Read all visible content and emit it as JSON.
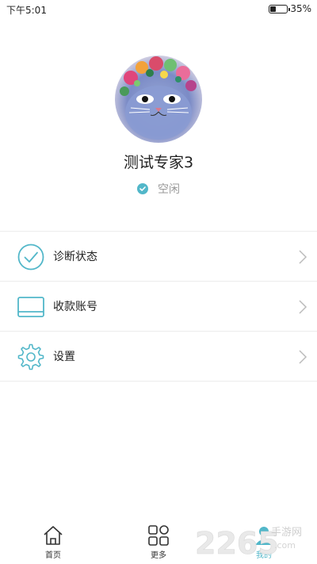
{
  "status_bar": {
    "time": "下午5:01",
    "battery_percent": "35%",
    "battery_level": 0.35
  },
  "profile": {
    "name": "测试专家3",
    "status": "空闲"
  },
  "menu": [
    {
      "label": "诊断状态",
      "icon": "check-circle-icon"
    },
    {
      "label": "收款账号",
      "icon": "card-icon"
    },
    {
      "label": "设置",
      "icon": "gear-icon"
    }
  ],
  "nav": [
    {
      "label": "首页",
      "icon": "home-icon"
    },
    {
      "label": "更多",
      "icon": "grid-icon"
    },
    {
      "label": "我的",
      "icon": "profile-icon",
      "active": true
    }
  ],
  "watermark": {
    "text": "2265",
    "suffix": "手游网",
    "domain": ".com"
  },
  "colors": {
    "accent": "#52b7c9",
    "divider": "#ececec"
  }
}
